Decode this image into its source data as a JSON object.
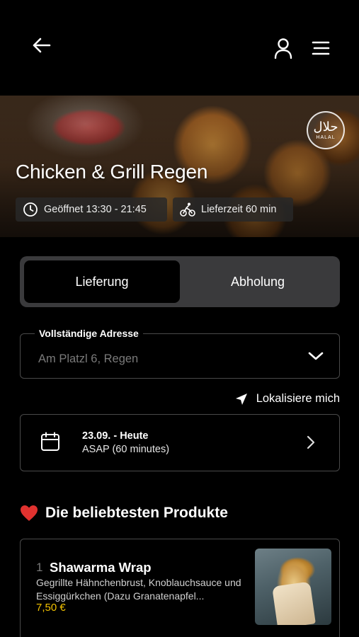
{
  "header": {
    "back_icon": "arrow-left-icon",
    "account_icon": "user-icon",
    "menu_icon": "hamburger-menu-icon"
  },
  "hero": {
    "restaurant_name": "Chicken & Grill Regen",
    "badge": {
      "script": "حلال",
      "label": "HALAL"
    },
    "opening_hours": "Geöffnet 13:30 - 21:45",
    "delivery_time": "Lieferzeit 60 min"
  },
  "order_mode": {
    "options": [
      "Lieferung",
      "Abholung"
    ],
    "selected": "Lieferung"
  },
  "address": {
    "label": "Vollständige Adresse",
    "value": "Am Platzl 6, Regen"
  },
  "locate": {
    "label": "Lokalisiere mich"
  },
  "schedule": {
    "date": "23.09. - Heute",
    "time": "ASAP (60 minutes)"
  },
  "popular": {
    "title": "Die beliebtesten Produkte",
    "items": [
      {
        "rank": "1",
        "name": "Shawarma Wrap",
        "description": "Gegrillte Hähnchenbrust, Knoblauchsauce und Essiggürkchen (Dazu Granatenapfel...",
        "price": "7,50 €"
      }
    ]
  },
  "colors": {
    "background": "#000000",
    "accent_price": "#f2c200",
    "heart": "#e0322f",
    "card_border": "#4a4a4a",
    "switch_bg": "#3a3a3c"
  }
}
